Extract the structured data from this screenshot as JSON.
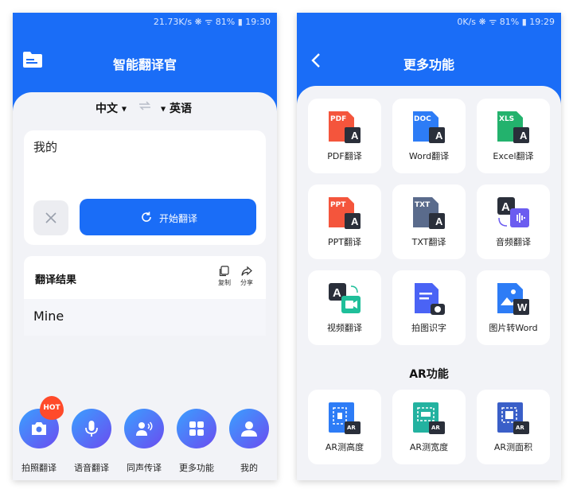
{
  "left": {
    "status": "21.73K/s ❋ ᯤ 81% ▮ 19:30",
    "title": "智能翻译官",
    "lang_from": "中文",
    "lang_to": "英语",
    "input_text": "我的",
    "translate_label": "开始翻译",
    "result_title": "翻译结果",
    "copy_label": "复制",
    "share_label": "分享",
    "result_text": "Mine",
    "hot_label": "HOT",
    "nav": [
      {
        "label": "拍照翻译",
        "icon": "camera-icon"
      },
      {
        "label": "语音翻译",
        "icon": "microphone-icon"
      },
      {
        "label": "同声传译",
        "icon": "speaker-icon"
      },
      {
        "label": "更多功能",
        "icon": "grid-icon"
      },
      {
        "label": "我的",
        "icon": "user-icon"
      }
    ]
  },
  "right": {
    "status": "0K/s ❋ ᯤ 81% ▮ 19:29",
    "title": "更多功能",
    "tiles": [
      {
        "label": "PDF翻译",
        "badge": "PDF",
        "color": "#f4553c",
        "icon": "pdf-file-icon"
      },
      {
        "label": "Word翻译",
        "badge": "DOC",
        "color": "#2d7cf6",
        "icon": "word-file-icon"
      },
      {
        "label": "Excel翻译",
        "badge": "XLS",
        "color": "#23b26d",
        "icon": "excel-file-icon"
      },
      {
        "label": "PPT翻译",
        "badge": "PPT",
        "color": "#f4553c",
        "icon": "ppt-file-icon"
      },
      {
        "label": "TXT翻译",
        "badge": "TXT",
        "color": "#5a6b8c",
        "icon": "txt-file-icon"
      },
      {
        "label": "音频翻译",
        "badge": "",
        "color": "#6b5cf0",
        "icon": "audio-icon"
      },
      {
        "label": "视频翻译",
        "badge": "",
        "color": "#1fbf9a",
        "icon": "video-icon"
      },
      {
        "label": "拍图识字",
        "badge": "",
        "color": "#4a63f5",
        "icon": "photo-text-icon"
      },
      {
        "label": "图片转Word",
        "badge": "",
        "color": "#2d7cf6",
        "icon": "image-word-icon"
      }
    ],
    "ar_title": "AR功能",
    "ar_tiles": [
      {
        "label": "AR测高度",
        "color": "#2d7cf6",
        "icon": "ar-height-icon"
      },
      {
        "label": "AR测宽度",
        "color": "#23b2a0",
        "icon": "ar-width-icon"
      },
      {
        "label": "AR测面积",
        "color": "#3a5fc8",
        "icon": "ar-area-icon"
      }
    ],
    "ar_badge": "AR"
  }
}
